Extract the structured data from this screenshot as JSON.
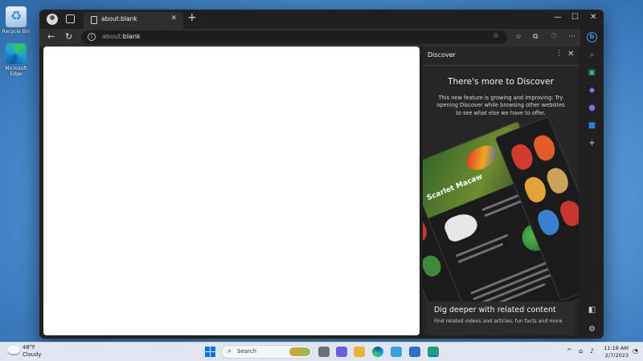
{
  "desktop": {
    "icons": [
      {
        "label": "Recycle Bin"
      },
      {
        "label": "Microsoft Edge"
      }
    ]
  },
  "browser": {
    "tab": {
      "title": "about:blank"
    },
    "address": {
      "scheme": "about:",
      "rest": "blank"
    }
  },
  "discover": {
    "title": "Discover",
    "heading": "There's more to Discover",
    "body": "This new feature is growing and improving: Try opening Discover while browsing other websites to see what else we have to offer.",
    "collage_caption": "Scarlet Macaw",
    "promo": {
      "title": "Dig deeper with related content",
      "subtitle": "Find related videos and articles, fun facts and more"
    }
  },
  "taskbar": {
    "weather": {
      "temp": "48°F",
      "condition": "Cloudy"
    },
    "search_label": "Search",
    "time": "11:18 AM",
    "date": "2/7/2023"
  },
  "colors": {
    "accent": "#3d9be9",
    "window_bg": "#202020",
    "start_blue": "#0a74da"
  }
}
